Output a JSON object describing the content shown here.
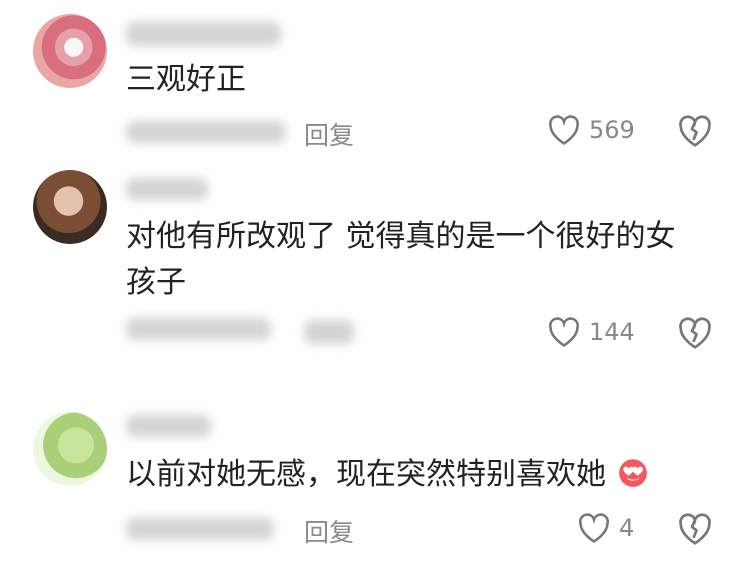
{
  "comments": [
    {
      "text_lines": [
        "三观好正"
      ],
      "reply_label": "回复",
      "likes": "569"
    },
    {
      "text_lines": [
        "对他有所改观了 觉得真的是一个很好的女",
        "孩子"
      ],
      "reply_label": "",
      "likes": "144"
    },
    {
      "text_lines": [
        "以前对她无感，现在突然特别喜欢她"
      ],
      "reply_label": "回复",
      "likes": "4"
    }
  ],
  "icons": {
    "like": "heart-outline-icon",
    "dislike": "broken-heart-icon",
    "emoji": "heart-eyes-face-emoji"
  },
  "colors": {
    "text": "#222222",
    "meta": "#8a8a8a",
    "icon": "#777777",
    "emoji": "#e8434f"
  }
}
